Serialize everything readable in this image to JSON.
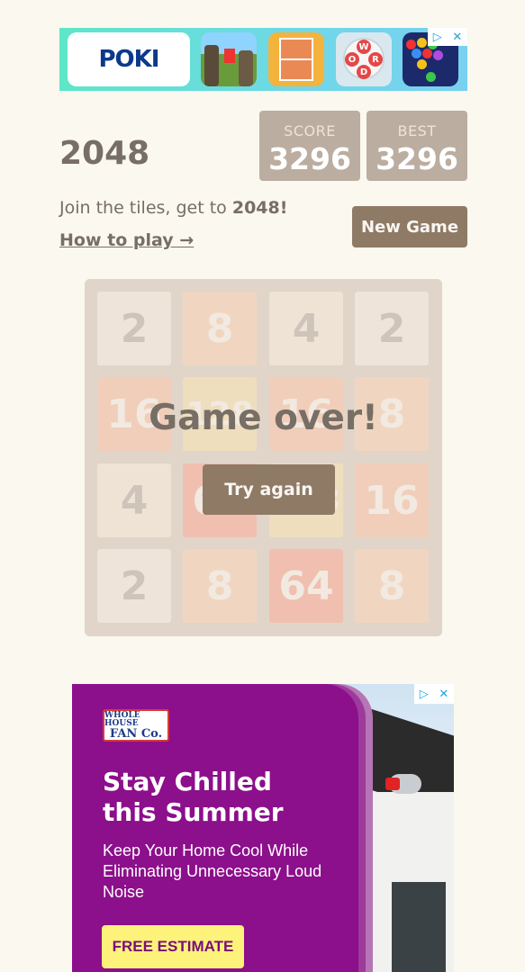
{
  "top_ad": {
    "brand": "POKI",
    "adchoices_icon": "adchoices-play-icon",
    "close_glyph": "✕",
    "thumb3_letters": [
      "W",
      "O",
      "R",
      "D"
    ]
  },
  "header": {
    "title": "2048",
    "score_label": "SCORE",
    "score_value": "3296",
    "best_label": "BEST",
    "best_value": "3296"
  },
  "intro": {
    "text_before": "Join the tiles, get to ",
    "text_bold": "2048!",
    "how_to_play": "How to play →"
  },
  "new_game_label": "New Game",
  "board": {
    "tiles": [
      [
        "2",
        "8",
        "4",
        "2"
      ],
      [
        "16",
        "128",
        "16",
        "8"
      ],
      [
        "4",
        "64",
        "128",
        "16"
      ],
      [
        "2",
        "8",
        "64",
        "8"
      ]
    ]
  },
  "overlay": {
    "message": "Game over!",
    "try_again_label": "Try again"
  },
  "bottom_ad": {
    "logo_line1": "WHOLE HOUSE",
    "logo_line2": "FAN Co.",
    "headline": "Stay Chilled this Summer",
    "body": "Keep Your Home Cool While Eliminating Unnecessary Loud Noise",
    "cta": "FREE ESTIMATE",
    "close_glyph": "✕"
  },
  "colors": {
    "background": "#faf8ef",
    "board": "#bbada0",
    "button": "#8f7a66",
    "ad_purple": "#8c0f8b",
    "cta_yellow": "#fdf27a"
  }
}
